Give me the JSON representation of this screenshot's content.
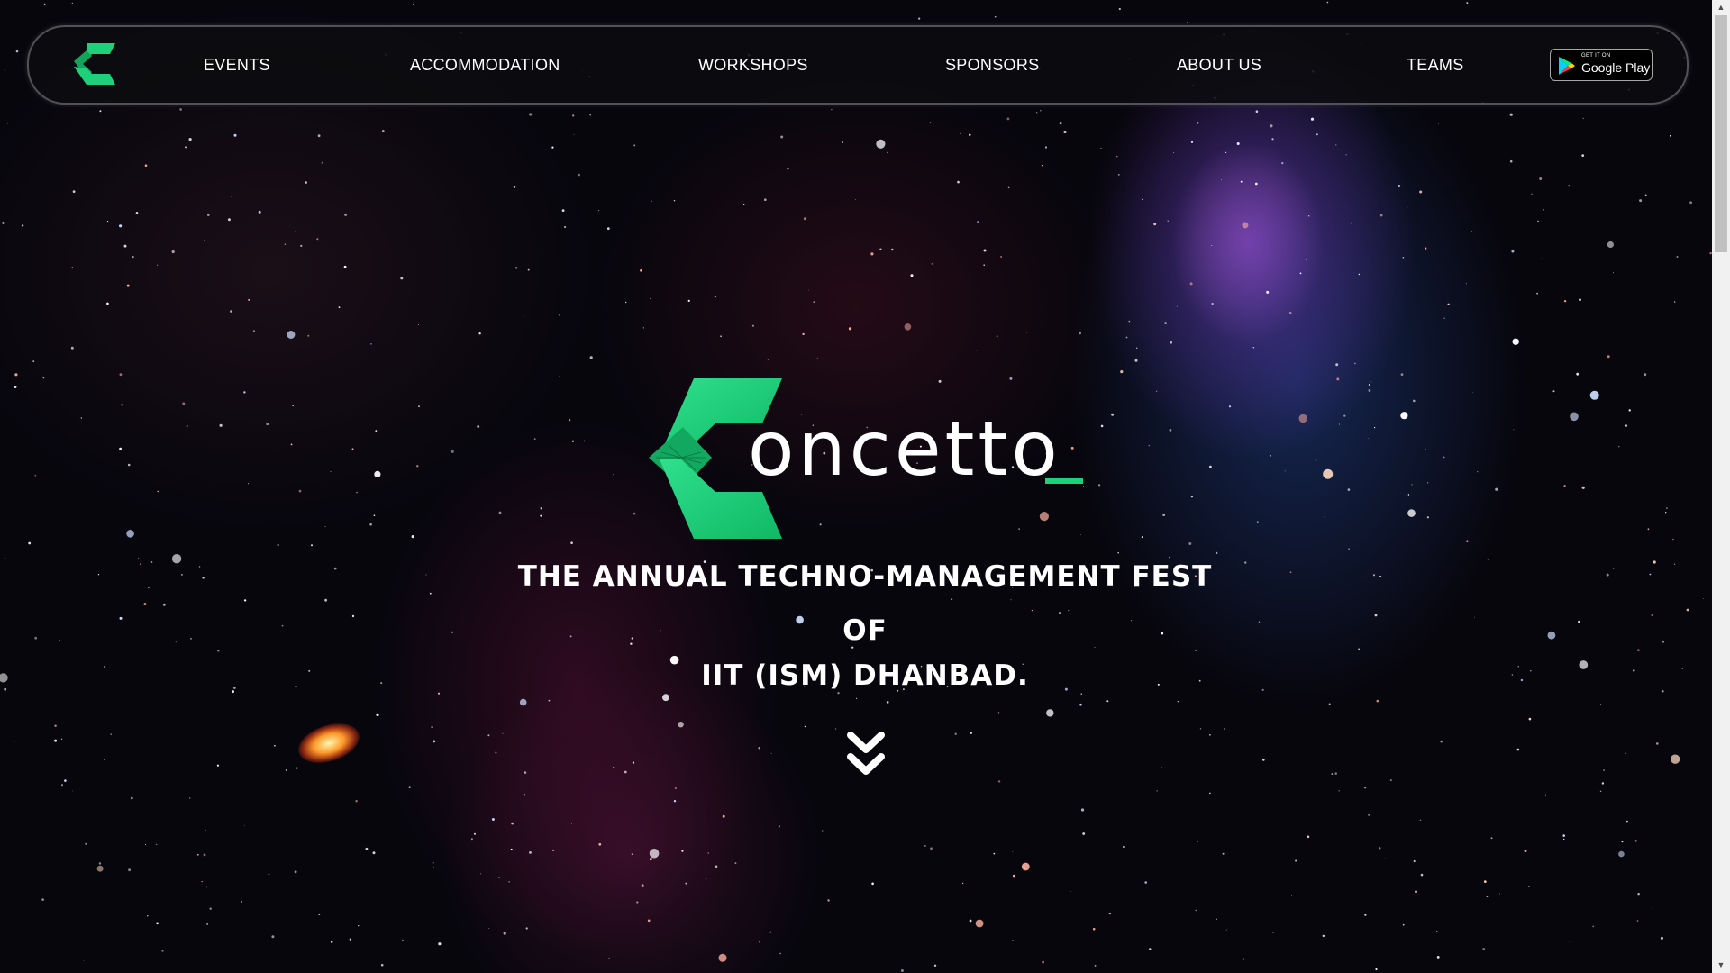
{
  "nav": {
    "logo_icon": "concetto-c-logo-icon",
    "items": [
      {
        "label": "EVENTS"
      },
      {
        "label": "ACCOMMODATION"
      },
      {
        "label": "WORKSHOPS"
      },
      {
        "label": "SPONSORS"
      },
      {
        "label": "ABOUT US"
      },
      {
        "label": "TEAMS"
      }
    ],
    "play_badge": {
      "small": "GET IT ON",
      "big": "Google Play",
      "icon": "google-play-icon"
    }
  },
  "hero": {
    "wordmark": "oncetto",
    "tagline_line1": "THE ANNUAL TECHNO-MANAGEMENT FEST",
    "tagline_line2": "OF",
    "tagline_line3": "IIT (ISM) DHANBAD.",
    "scroll_icon": "double-chevron-down-icon"
  },
  "colors": {
    "accent": "#1fd07a",
    "accent_dark": "#12a35c",
    "nav_bg": "#0c0c10",
    "text": "#ffffff"
  }
}
